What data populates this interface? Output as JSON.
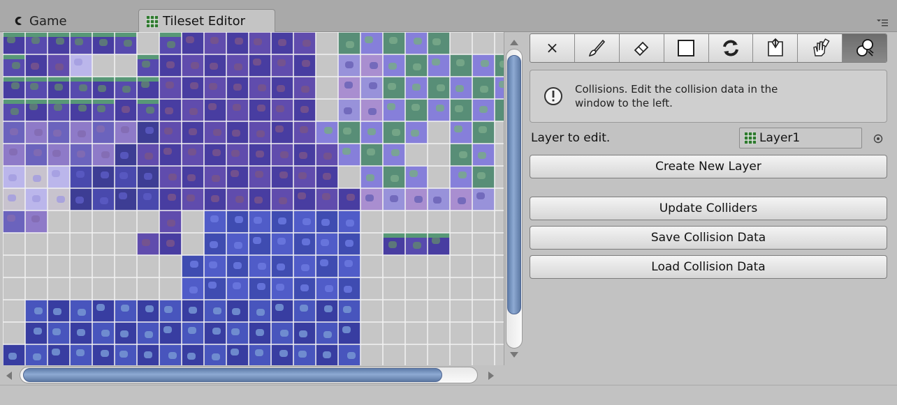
{
  "tabs": [
    {
      "label": "Game",
      "icon": "game-icon",
      "active": false
    },
    {
      "label": "Tileset Editor",
      "icon": "grid-icon",
      "active": true
    }
  ],
  "toolbar": {
    "tools": [
      {
        "name": "clear",
        "glyph": "×"
      },
      {
        "name": "brush",
        "icon": "brush-icon"
      },
      {
        "name": "eraser",
        "icon": "eraser-icon"
      },
      {
        "name": "rectangle",
        "icon": "rectangle-icon"
      },
      {
        "name": "refresh",
        "icon": "refresh-icon"
      },
      {
        "name": "flip",
        "icon": "flip-icon"
      },
      {
        "name": "paint",
        "icon": "paint-hand-icon"
      },
      {
        "name": "collisions",
        "icon": "collision-icon",
        "selected": true
      }
    ]
  },
  "help": {
    "line1": "Collisions. Edit the collision data in the",
    "line2": "window to the left."
  },
  "layer": {
    "label": "Layer to edit.",
    "value": "Layer1"
  },
  "buttons": {
    "create_layer": "Create New Layer",
    "update_colliders": "Update Colliders",
    "save_collision": "Save Collision Data",
    "load_collision": "Load Collision Data"
  },
  "colors": {
    "panel_bg": "#c2c2c2",
    "tab_bar": "#a9a9a9",
    "scroll_thumb": "#7b96c1",
    "tile_overlay": "#7070e0"
  }
}
